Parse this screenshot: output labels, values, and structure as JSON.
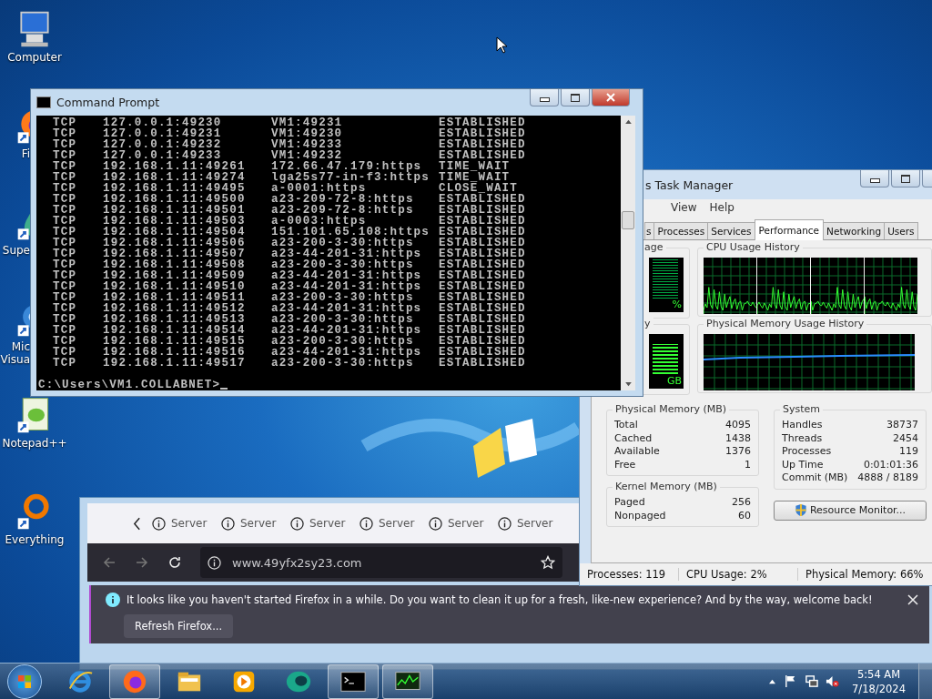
{
  "desktop_icons": [
    {
      "lines": [
        "Computer"
      ],
      "kind": "computer",
      "shortcut": false,
      "partly_hidden": false
    },
    {
      "lines": [
        "Fi"
      ],
      "kind": "firefox",
      "shortcut": true,
      "partly_hidden": true
    },
    {
      "lines": [
        "Supe"
      ],
      "kind": "drop",
      "shortcut": true,
      "partly_hidden": true
    },
    {
      "lines": [
        "Mic",
        "Visua"
      ],
      "kind": "studio",
      "shortcut": true,
      "partly_hidden": true
    },
    {
      "lines": [
        "Notepad++"
      ],
      "kind": "notepad",
      "shortcut": true,
      "partly_hidden": false
    },
    {
      "lines": [
        "Everything"
      ],
      "kind": "everything",
      "shortcut": true,
      "partly_hidden": false
    }
  ],
  "command_prompt": {
    "title": "Command Prompt",
    "rows": [
      {
        "proto": "TCP",
        "local": "127.0.0.1:49230",
        "foreign": "VM1:49231",
        "state": "ESTABLISHED"
      },
      {
        "proto": "TCP",
        "local": "127.0.0.1:49231",
        "foreign": "VM1:49230",
        "state": "ESTABLISHED"
      },
      {
        "proto": "TCP",
        "local": "127.0.0.1:49232",
        "foreign": "VM1:49233",
        "state": "ESTABLISHED"
      },
      {
        "proto": "TCP",
        "local": "127.0.0.1:49233",
        "foreign": "VM1:49232",
        "state": "ESTABLISHED"
      },
      {
        "proto": "TCP",
        "local": "192.168.1.11:49261",
        "foreign": "172.66.47.179:https",
        "state": "TIME_WAIT"
      },
      {
        "proto": "TCP",
        "local": "192.168.1.11:49274",
        "foreign": "lga25s77-in-f3:https",
        "state": "TIME_WAIT"
      },
      {
        "proto": "TCP",
        "local": "192.168.1.11:49495",
        "foreign": "a-0001:https",
        "state": "CLOSE_WAIT"
      },
      {
        "proto": "TCP",
        "local": "192.168.1.11:49500",
        "foreign": "a23-209-72-8:https",
        "state": "ESTABLISHED"
      },
      {
        "proto": "TCP",
        "local": "192.168.1.11:49501",
        "foreign": "a23-209-72-8:https",
        "state": "ESTABLISHED"
      },
      {
        "proto": "TCP",
        "local": "192.168.1.11:49503",
        "foreign": "a-0003:https",
        "state": "ESTABLISHED"
      },
      {
        "proto": "TCP",
        "local": "192.168.1.11:49504",
        "foreign": "151.101.65.108:https",
        "state": "ESTABLISHED"
      },
      {
        "proto": "TCP",
        "local": "192.168.1.11:49506",
        "foreign": "a23-200-3-30:https",
        "state": "ESTABLISHED"
      },
      {
        "proto": "TCP",
        "local": "192.168.1.11:49507",
        "foreign": "a23-44-201-31:https",
        "state": "ESTABLISHED"
      },
      {
        "proto": "TCP",
        "local": "192.168.1.11:49508",
        "foreign": "a23-200-3-30:https",
        "state": "ESTABLISHED"
      },
      {
        "proto": "TCP",
        "local": "192.168.1.11:49509",
        "foreign": "a23-44-201-31:https",
        "state": "ESTABLISHED"
      },
      {
        "proto": "TCP",
        "local": "192.168.1.11:49510",
        "foreign": "a23-44-201-31:https",
        "state": "ESTABLISHED"
      },
      {
        "proto": "TCP",
        "local": "192.168.1.11:49511",
        "foreign": "a23-200-3-30:https",
        "state": "ESTABLISHED"
      },
      {
        "proto": "TCP",
        "local": "192.168.1.11:49512",
        "foreign": "a23-44-201-31:https",
        "state": "ESTABLISHED"
      },
      {
        "proto": "TCP",
        "local": "192.168.1.11:49513",
        "foreign": "a23-200-3-30:https",
        "state": "ESTABLISHED"
      },
      {
        "proto": "TCP",
        "local": "192.168.1.11:49514",
        "foreign": "a23-44-201-31:https",
        "state": "ESTABLISHED"
      },
      {
        "proto": "TCP",
        "local": "192.168.1.11:49515",
        "foreign": "a23-200-3-30:https",
        "state": "ESTABLISHED"
      },
      {
        "proto": "TCP",
        "local": "192.168.1.11:49516",
        "foreign": "a23-44-201-31:https",
        "state": "ESTABLISHED"
      },
      {
        "proto": "TCP",
        "local": "192.168.1.11:49517",
        "foreign": "a23-200-3-30:https",
        "state": "ESTABLISHED"
      }
    ],
    "prompt": "C:\\Users\\VM1.COLLABNET>"
  },
  "task_manager": {
    "title": "s Task Manager",
    "menu": [
      "View",
      "Help"
    ],
    "tabs": [
      {
        "label": "s",
        "selected": false
      },
      {
        "label": "Processes",
        "selected": false
      },
      {
        "label": "Services",
        "selected": false
      },
      {
        "label": "Performance",
        "selected": true
      },
      {
        "label": "Networking",
        "selected": false
      },
      {
        "label": "Users",
        "selected": false
      }
    ],
    "cpu_gauge": {
      "title": "age",
      "reading": "%"
    },
    "cpu_history": {
      "title": "CPU Usage History"
    },
    "memory_gauge": {
      "title": "y",
      "reading": "GB"
    },
    "memory_history": {
      "title": "Physical Memory Usage History"
    },
    "physical_memory": {
      "title": "Physical Memory (MB)",
      "rows": [
        {
          "label": "Total",
          "value": "4095"
        },
        {
          "label": "Cached",
          "value": "1438"
        },
        {
          "label": "Available",
          "value": "1376"
        },
        {
          "label": "Free",
          "value": "1"
        }
      ]
    },
    "kernel_memory": {
      "title": "Kernel Memory (MB)",
      "rows": [
        {
          "label": "Paged",
          "value": "256"
        },
        {
          "label": "Nonpaged",
          "value": "60"
        }
      ]
    },
    "system": {
      "title": "System",
      "rows": [
        {
          "label": "Handles",
          "value": "38737"
        },
        {
          "label": "Threads",
          "value": "2454"
        },
        {
          "label": "Processes",
          "value": "119"
        },
        {
          "label": "Up Time",
          "value": "0:01:01:36"
        },
        {
          "label": "Commit (MB)",
          "value": "4888 / 8189"
        }
      ]
    },
    "resource_monitor_button": "Resource Monitor...",
    "status_bar": [
      "Processes: 119",
      "CPU Usage: 2%",
      "Physical Memory: 66%"
    ]
  },
  "firefox": {
    "tabs": [
      {
        "label": "Server"
      },
      {
        "label": "Server"
      },
      {
        "label": "Server"
      },
      {
        "label": "Server"
      },
      {
        "label": "Server"
      },
      {
        "label": "Server"
      }
    ],
    "url": "www.49yfx2sy23.com",
    "notification": "It looks like you haven't started Firefox in a while. Do you want to clean it up for a fresh, like-new experience? And by the way, welcome back!",
    "notification_button": "Refresh Firefox..."
  },
  "taskbar": {
    "items": [
      {
        "kind": "ie",
        "running": false
      },
      {
        "kind": "firefox",
        "running": true
      },
      {
        "kind": "explorer",
        "running": false
      },
      {
        "kind": "media",
        "running": false
      },
      {
        "kind": "teal",
        "running": false
      },
      {
        "kind": "cmd",
        "running": true
      },
      {
        "kind": "taskmgr",
        "running": true
      }
    ],
    "time": "5:54 AM",
    "date": "7/18/2024"
  }
}
